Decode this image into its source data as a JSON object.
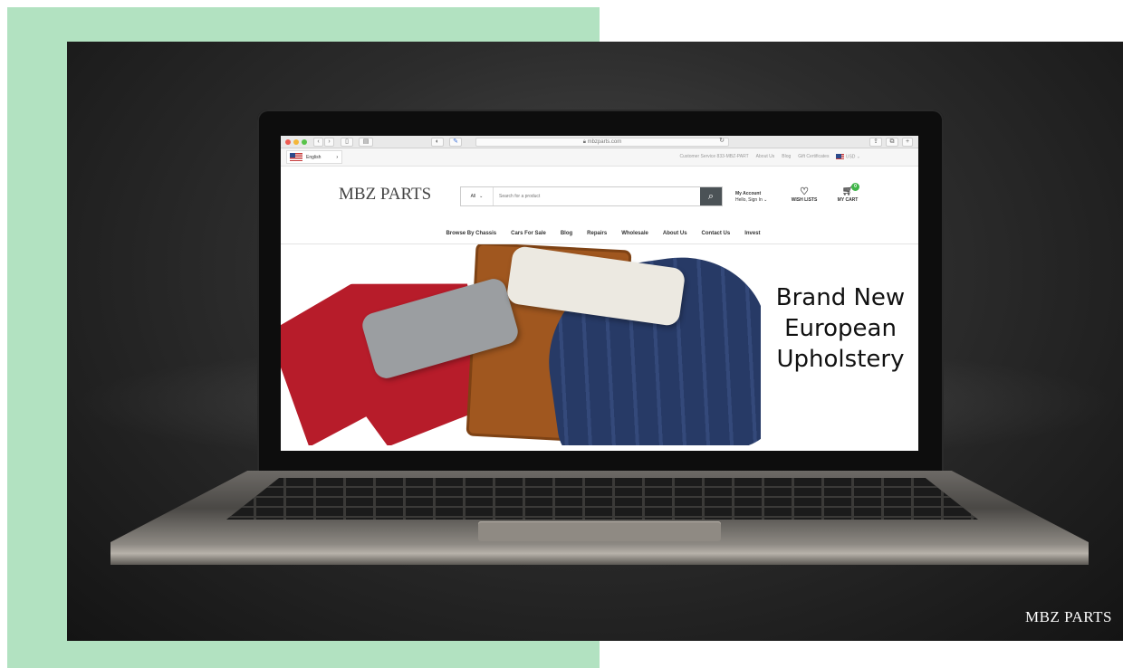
{
  "browser": {
    "url": "mbzparts.com"
  },
  "topbar": {
    "language": "English",
    "links": [
      "Customer Service 833-MBZ-PART",
      "About Us",
      "Blog",
      "Gift Certificates",
      "USD"
    ]
  },
  "header": {
    "logo_text": "MBZ PARTS",
    "search_category": "All",
    "search_placeholder": "Search for a product",
    "account_title": "My Account",
    "account_sub": "Hello, Sign In",
    "wishlist_label": "WISH LISTS",
    "cart_label": "MY CART",
    "cart_count": "0"
  },
  "nav": {
    "items": [
      "Browse By Chassis",
      "Cars For Sale",
      "Blog",
      "Repairs",
      "Wholesale",
      "About Us",
      "Contact Us",
      "Invest"
    ]
  },
  "hero": {
    "title": "Brand New\nEuropean\nUpholstery"
  },
  "watermark": "MBZ PARTS",
  "colors": {
    "green_block": "#b2e2c1",
    "search_button": "#4b5256",
    "cart_badge": "#3fb548"
  }
}
